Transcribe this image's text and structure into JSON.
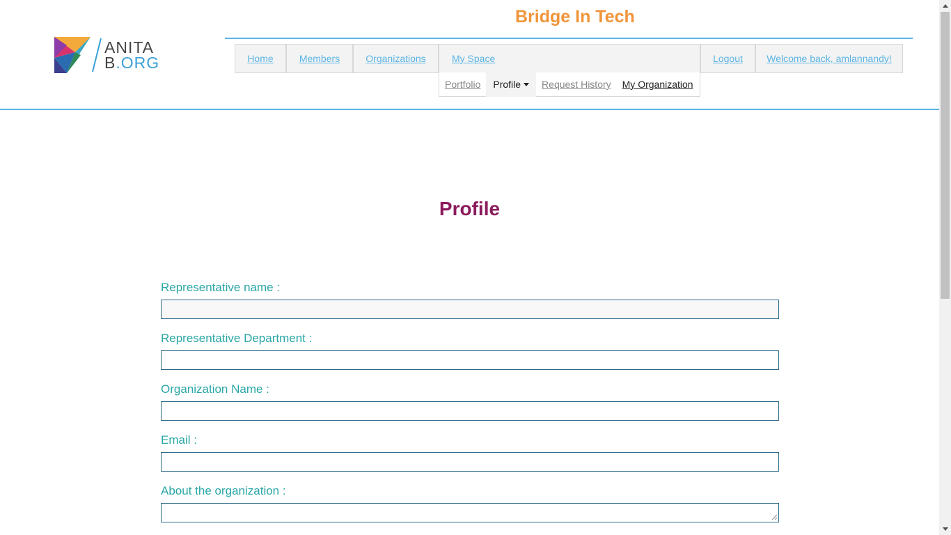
{
  "header": {
    "logo_line1": "ANITA",
    "logo_line2_b": "B",
    "logo_line2_dot": ".",
    "logo_line2_org": "ORG",
    "brand": "Bridge In Tech"
  },
  "nav": {
    "home": "Home",
    "members": "Members",
    "organizations": "Organizations",
    "my_space": "My Space",
    "logout": "Logout",
    "welcome": "Welcome back, amlannandy!"
  },
  "subnav": {
    "portfolio": "Portfolio",
    "profile": "Profile",
    "request_history": "Request History",
    "my_organization": "My Organization"
  },
  "main": {
    "title": "Profile",
    "fields": {
      "rep_name_label": "Representative name :",
      "rep_name_value": "",
      "rep_dept_label": "Representative Department :",
      "rep_dept_value": "",
      "org_name_label": "Organization Name :",
      "org_name_value": "",
      "email_label": "Email :",
      "email_value": "",
      "about_label": "About the organization :",
      "about_value": ""
    }
  },
  "colors": {
    "brand_orange": "#f0953a",
    "accent_blue": "#5ab4e5",
    "title_magenta": "#8b1a5c",
    "label_teal": "#2aa6a6",
    "input_border": "#2c6a8a"
  },
  "icons": {
    "logo": "anitab-logo-icon",
    "dropdown": "caret-down-icon"
  }
}
